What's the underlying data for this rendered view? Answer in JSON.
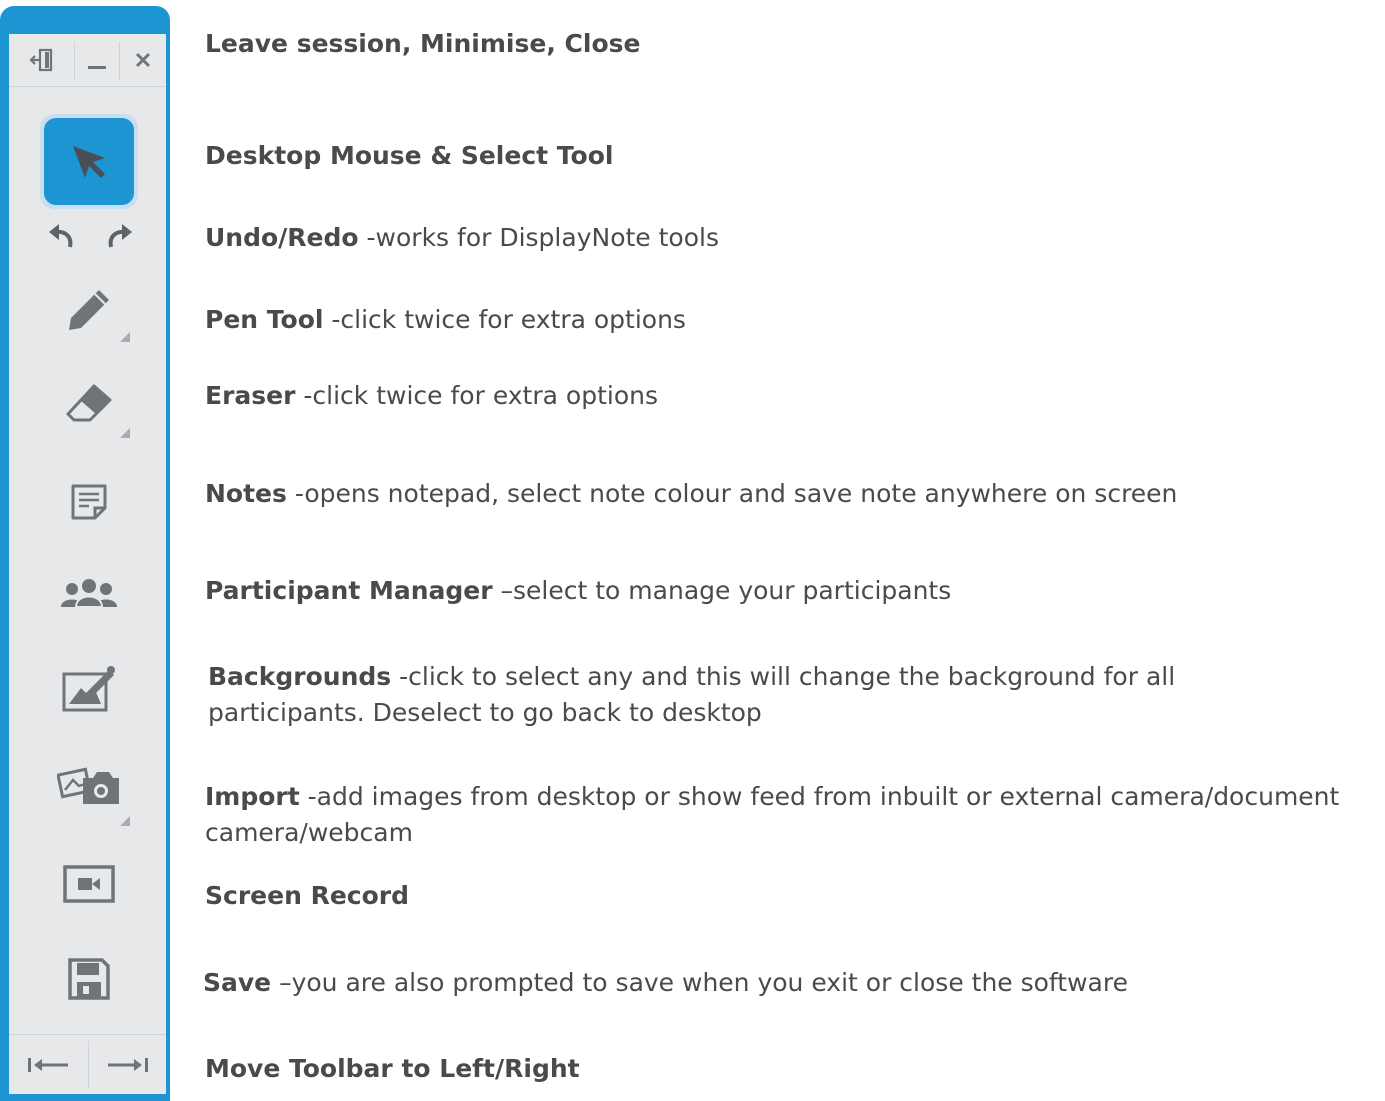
{
  "colors": {
    "accent": "#1e95d3",
    "panel": "#e7e8ea",
    "icon": "#6f7479"
  },
  "toolbar": {
    "top_icons": [
      "leave-session-icon",
      "minimise-icon",
      "close-icon"
    ],
    "tools": [
      "select-arrow-icon",
      "undo-icon",
      "redo-icon",
      "pen-icon",
      "eraser-icon",
      "notes-icon",
      "participants-icon",
      "backgrounds-icon",
      "import-camera-icon",
      "screen-record-icon",
      "save-icon"
    ],
    "bottom_icons": [
      "move-left-icon",
      "move-right-icon"
    ]
  },
  "labels": {
    "window": {
      "title": "Leave session, Minimise, Close"
    },
    "select": {
      "title": "Desktop Mouse & Select Tool"
    },
    "undo": {
      "title": "Undo/Redo",
      "desc": " -works for DisplayNote tools"
    },
    "pen": {
      "title": "Pen Tool",
      "desc": " -click twice for extra options"
    },
    "eraser": {
      "title": "Eraser",
      "desc": " -click twice for extra options"
    },
    "notes": {
      "title": "Notes",
      "desc": " -opens notepad, select note colour and save note anywhere on screen"
    },
    "participants": {
      "title": "Participant Manager",
      "desc": " –select to manage your participants"
    },
    "backgrounds": {
      "title": "Backgrounds",
      "desc": " -click to select any and this will change the background for all participants.  Deselect to go back to desktop"
    },
    "import": {
      "title": "Import",
      "desc": " -add images from desktop or show feed from inbuilt or external camera/document camera/webcam"
    },
    "record": {
      "title": "Screen Record"
    },
    "save": {
      "title": "Save",
      "desc": " –you are also prompted to save when you exit or close the software"
    },
    "move": {
      "title": "Move Toolbar to Left/Right"
    }
  }
}
